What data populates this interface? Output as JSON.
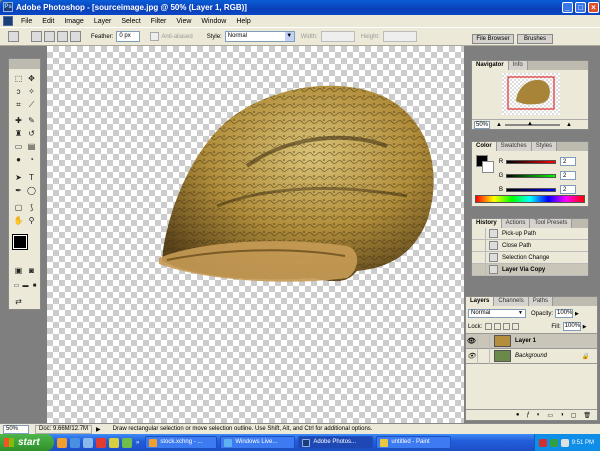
{
  "window": {
    "title": "Adobe Photoshop - [sourceimage.jpg @ 50% (Layer 1, RGB)]",
    "min_label": "_",
    "max_label": "□",
    "close_label": "×"
  },
  "menu": [
    "File",
    "Edit",
    "Image",
    "Layer",
    "Select",
    "Filter",
    "View",
    "Window",
    "Help"
  ],
  "options_bar": {
    "feather_label": "Feather:",
    "feather_value": "0 px",
    "antialiased_label": "Anti-aliased",
    "style_label": "Style:",
    "style_value": "Normal",
    "width_label": "Width:",
    "height_label": "Height:",
    "file_browser_tab": "File Browser",
    "brushes_tab": "Brushes"
  },
  "navigator": {
    "tabs": [
      "Navigator",
      "Info"
    ],
    "zoom": "50%"
  },
  "color_panel": {
    "tabs": [
      "Color",
      "Swatches",
      "Styles"
    ],
    "channels": [
      {
        "label": "R",
        "value": "2"
      },
      {
        "label": "G",
        "value": "2"
      },
      {
        "label": "B",
        "value": "2"
      }
    ]
  },
  "history": {
    "tabs": [
      "History",
      "Actions",
      "Tool Presets"
    ],
    "items": [
      "Pick-up Path",
      "Close Path",
      "Selection Change",
      "Layer Via Copy"
    ]
  },
  "layers": {
    "tabs": [
      "Layers",
      "Channels",
      "Paths"
    ],
    "blend_mode": "Normal",
    "opacity_label": "Opacity:",
    "opacity_value": "100%",
    "lock_label": "Lock:",
    "fill_label": "Fill:",
    "fill_value": "100%",
    "items": [
      {
        "name": "Layer 1"
      },
      {
        "name": "Background"
      }
    ]
  },
  "status": {
    "zoom": "50%",
    "doc": "Doc: 9.66M/12.7M",
    "hint": "Draw rectangular selection or move selection outline. Use Shift, Alt, and Ctrl for additional options."
  },
  "taskbar": {
    "start": "start",
    "tasks": [
      {
        "label": "stock.xchng - ...",
        "active": false
      },
      {
        "label": "Windows Live...",
        "active": false
      },
      {
        "label": "Adobe Photos...",
        "active": true
      },
      {
        "label": "untitled - Paint",
        "active": false
      }
    ],
    "clock": "9:51 PM"
  },
  "colors": {
    "title_blue": "#0a4fc8",
    "chrome": "#ece9d8",
    "start_green": "#3a9d36",
    "history_selected": "#c9c5b9"
  }
}
